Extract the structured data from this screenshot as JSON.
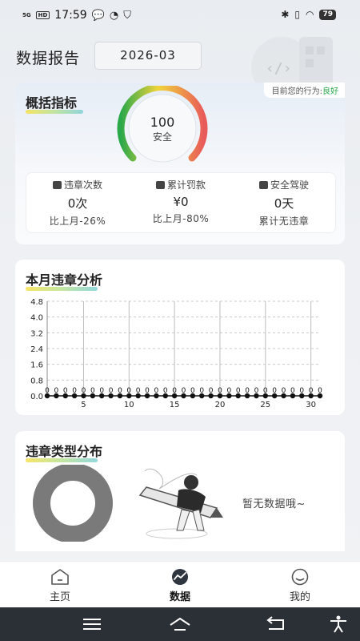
{
  "status_bar": {
    "network": "5G",
    "hd": "HD",
    "time": "17:59",
    "battery": "79"
  },
  "header": {
    "title": "数据报告",
    "date": "2026-03"
  },
  "overview": {
    "title": "概括指标",
    "behavior_prefix": "目前您的行为:",
    "behavior_value": "良好",
    "score": "100",
    "score_label": "安全",
    "score_value": 100,
    "stats": [
      {
        "label": "违章次数",
        "value": "0次",
        "sub": "比上月-26%",
        "icon": "car-icon"
      },
      {
        "label": "累计罚款",
        "value": "¥0",
        "sub": "比上月-80%",
        "icon": "fine-icon"
      },
      {
        "label": "安全驾驶",
        "value": "0天",
        "sub": "累计无违章",
        "icon": "car-icon"
      }
    ]
  },
  "analysis": {
    "title": "本月违章分析",
    "chart_data": {
      "type": "line",
      "x": [
        1,
        2,
        3,
        4,
        5,
        6,
        7,
        8,
        9,
        10,
        11,
        12,
        13,
        14,
        15,
        16,
        17,
        18,
        19,
        20,
        21,
        22,
        23,
        24,
        25,
        26,
        27,
        28,
        29,
        30,
        31
      ],
      "series": [
        {
          "values": [
            0,
            0,
            0,
            0,
            0,
            0,
            0,
            0,
            0,
            0,
            0,
            0,
            0,
            0,
            0,
            0,
            0,
            0,
            0,
            0,
            0,
            0,
            0,
            0,
            0,
            0,
            0,
            0,
            0,
            0,
            0
          ]
        }
      ],
      "xticks": [
        "5",
        "10",
        "15",
        "20",
        "25",
        "30"
      ],
      "yticks": [
        "0.0",
        "0.8",
        "1.6",
        "2.4",
        "3.2",
        "4.0",
        "4.8"
      ],
      "ylim": [
        0,
        4.8
      ],
      "grid": true
    }
  },
  "distribution": {
    "title": "违章类型分布",
    "empty_text": "暂无数据哦~"
  },
  "tabbar": {
    "items": [
      {
        "label": "主页",
        "icon": "home-icon"
      },
      {
        "label": "数据",
        "icon": "chart-icon",
        "active": true
      },
      {
        "label": "我的",
        "icon": "smile-icon"
      }
    ]
  },
  "colors": {
    "good": "#2aa84a",
    "gauge_start": "#2aa84a",
    "gauge_mid": "#f1d43a",
    "gauge_end": "#e85a5a",
    "donut": "#7a7a7a"
  }
}
